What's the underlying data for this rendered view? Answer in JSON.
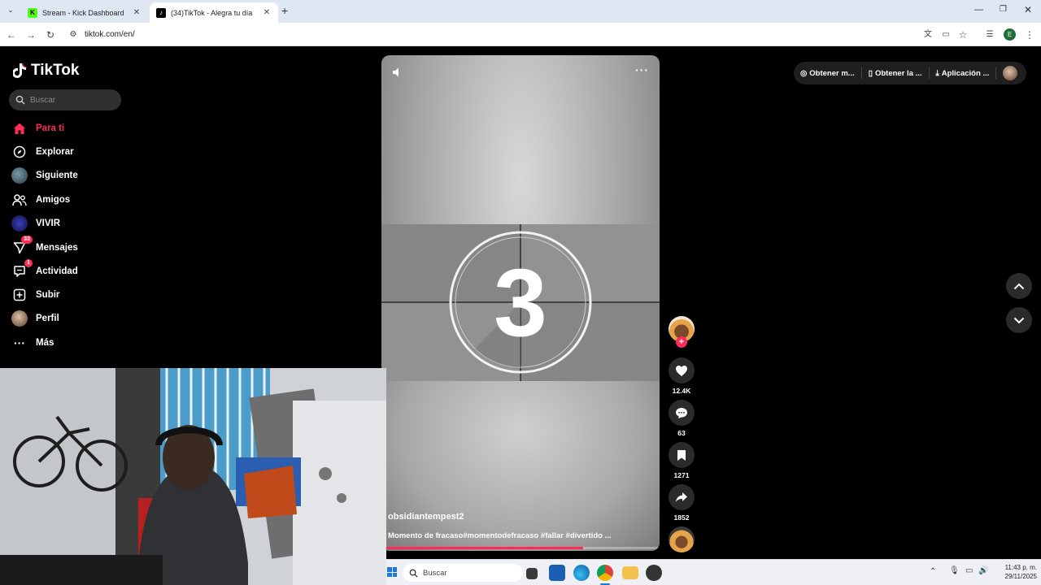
{
  "browser": {
    "tabs": [
      {
        "title": "Stream - Kick Dashboard",
        "active": false
      },
      {
        "title": "(34)TikTok - Alegra tu día",
        "active": true
      }
    ],
    "address": "tiktok.com/en/",
    "profile_initial": "E"
  },
  "tiktok": {
    "logo": "TikTok",
    "search_placeholder": "Buscar",
    "nav": [
      {
        "label": "Para ti",
        "icon": "home-icon",
        "active": true
      },
      {
        "label": "Explorar",
        "icon": "compass-icon"
      },
      {
        "label": "Siguiente",
        "icon": "avatar-icon"
      },
      {
        "label": "Amigos",
        "icon": "friends-icon"
      },
      {
        "label": "VIVIR",
        "icon": "live-icon"
      },
      {
        "label": "Mensajes",
        "icon": "paper-plane-icon",
        "badge": "33"
      },
      {
        "label": "Actividad",
        "icon": "activity-icon",
        "badge": "1"
      },
      {
        "label": "Subir",
        "icon": "upload-icon"
      },
      {
        "label": "Perfil",
        "icon": "profile-icon"
      },
      {
        "label": "Más",
        "icon": "more-icon"
      }
    ],
    "top_actions": [
      {
        "label": "Obtener m...",
        "icon": "coin-icon"
      },
      {
        "label": "Obtener la ...",
        "icon": "phone-icon"
      },
      {
        "label": "Aplicación ...",
        "icon": "download-icon"
      }
    ],
    "video": {
      "countdown_number": "3",
      "username": "obsidiantempest2",
      "caption": "Momento de fracaso#momentodefracaso #fallar #divertido ...",
      "progress": 0.72
    },
    "actions": {
      "likes": "12.4K",
      "comments": "63",
      "saves": "1271",
      "shares": "1852"
    }
  },
  "taskbar": {
    "search_placeholder": "Buscar",
    "time": "11:43 p. m.",
    "date": "29/11/2025"
  },
  "colors": {
    "accent": "#fe2c55",
    "background": "#000000"
  }
}
